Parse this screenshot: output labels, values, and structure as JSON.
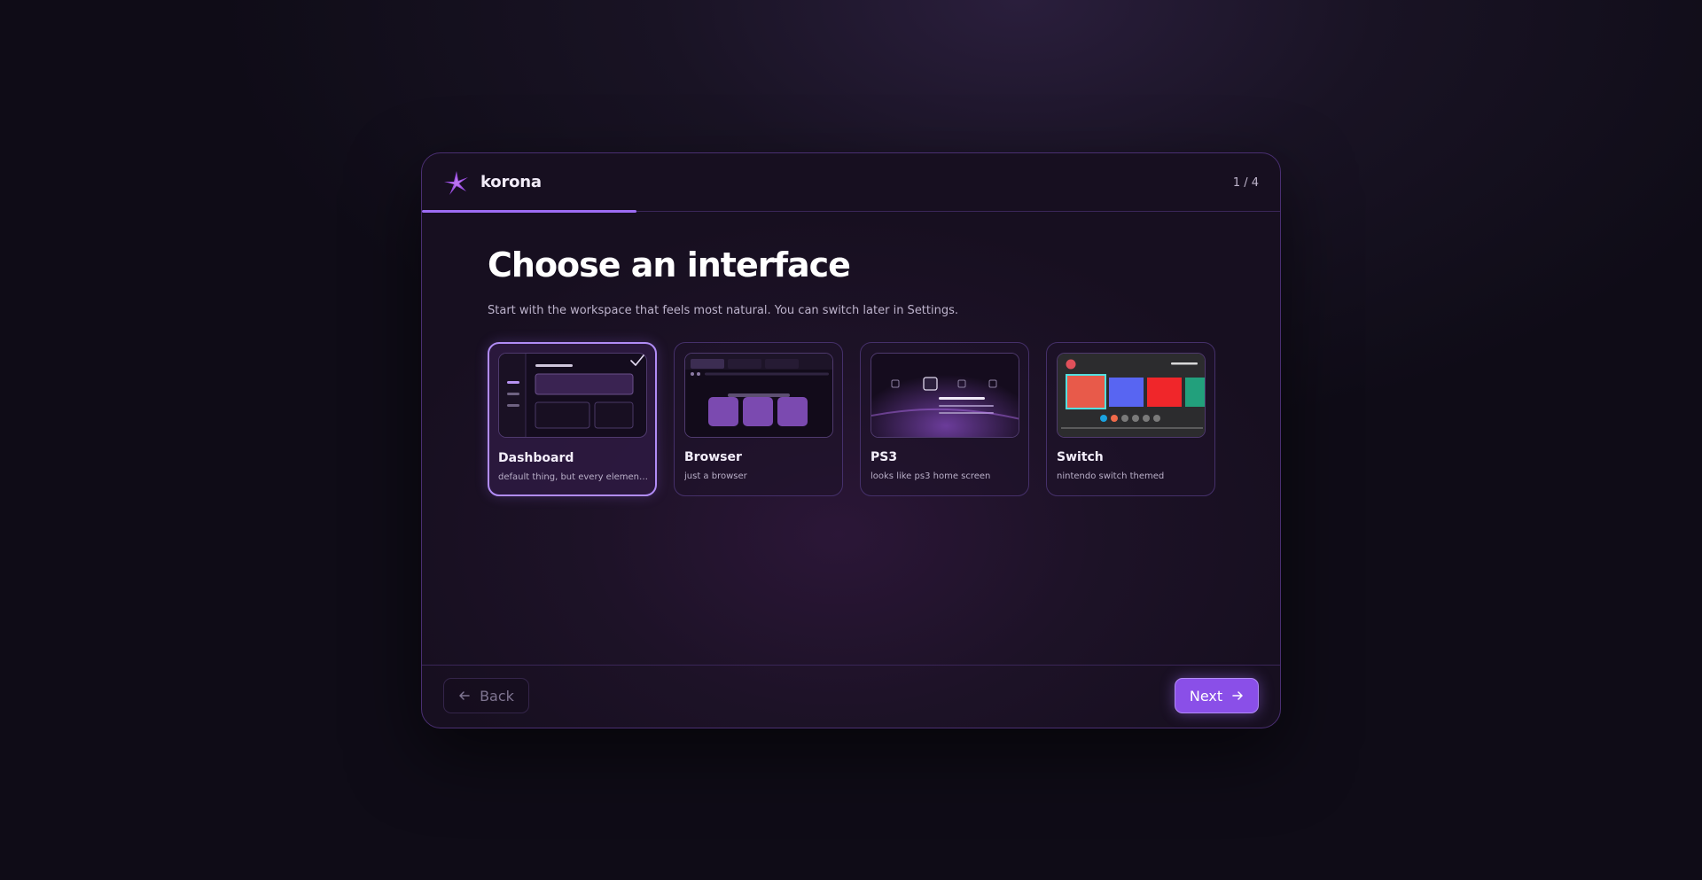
{
  "app": {
    "name": "korona",
    "step": "1 / 4",
    "progress": 0.25
  },
  "page": {
    "title": "Choose an interface",
    "subtitle": "Start with the workspace that feels most natural. You can switch later in Settings."
  },
  "options": [
    {
      "name": "Dashboard",
      "description": "default thing, but every element is a widget",
      "selected": true
    },
    {
      "name": "Browser",
      "description": "just a browser",
      "selected": false
    },
    {
      "name": "PS3",
      "description": "looks like ps3 home screen",
      "selected": false
    },
    {
      "name": "Switch",
      "description": "nintendo switch themed",
      "selected": false
    }
  ],
  "footer": {
    "back_label": "Back",
    "next_label": "Next"
  },
  "icons": {
    "logo": "korona-star-logo-icon",
    "check": "checkmark-icon",
    "back": "arrow-left-icon",
    "next": "arrow-right-icon"
  },
  "colors": {
    "accent": "#9d6cf4",
    "button": "#8a4fe8",
    "background": "#0f0c17"
  }
}
